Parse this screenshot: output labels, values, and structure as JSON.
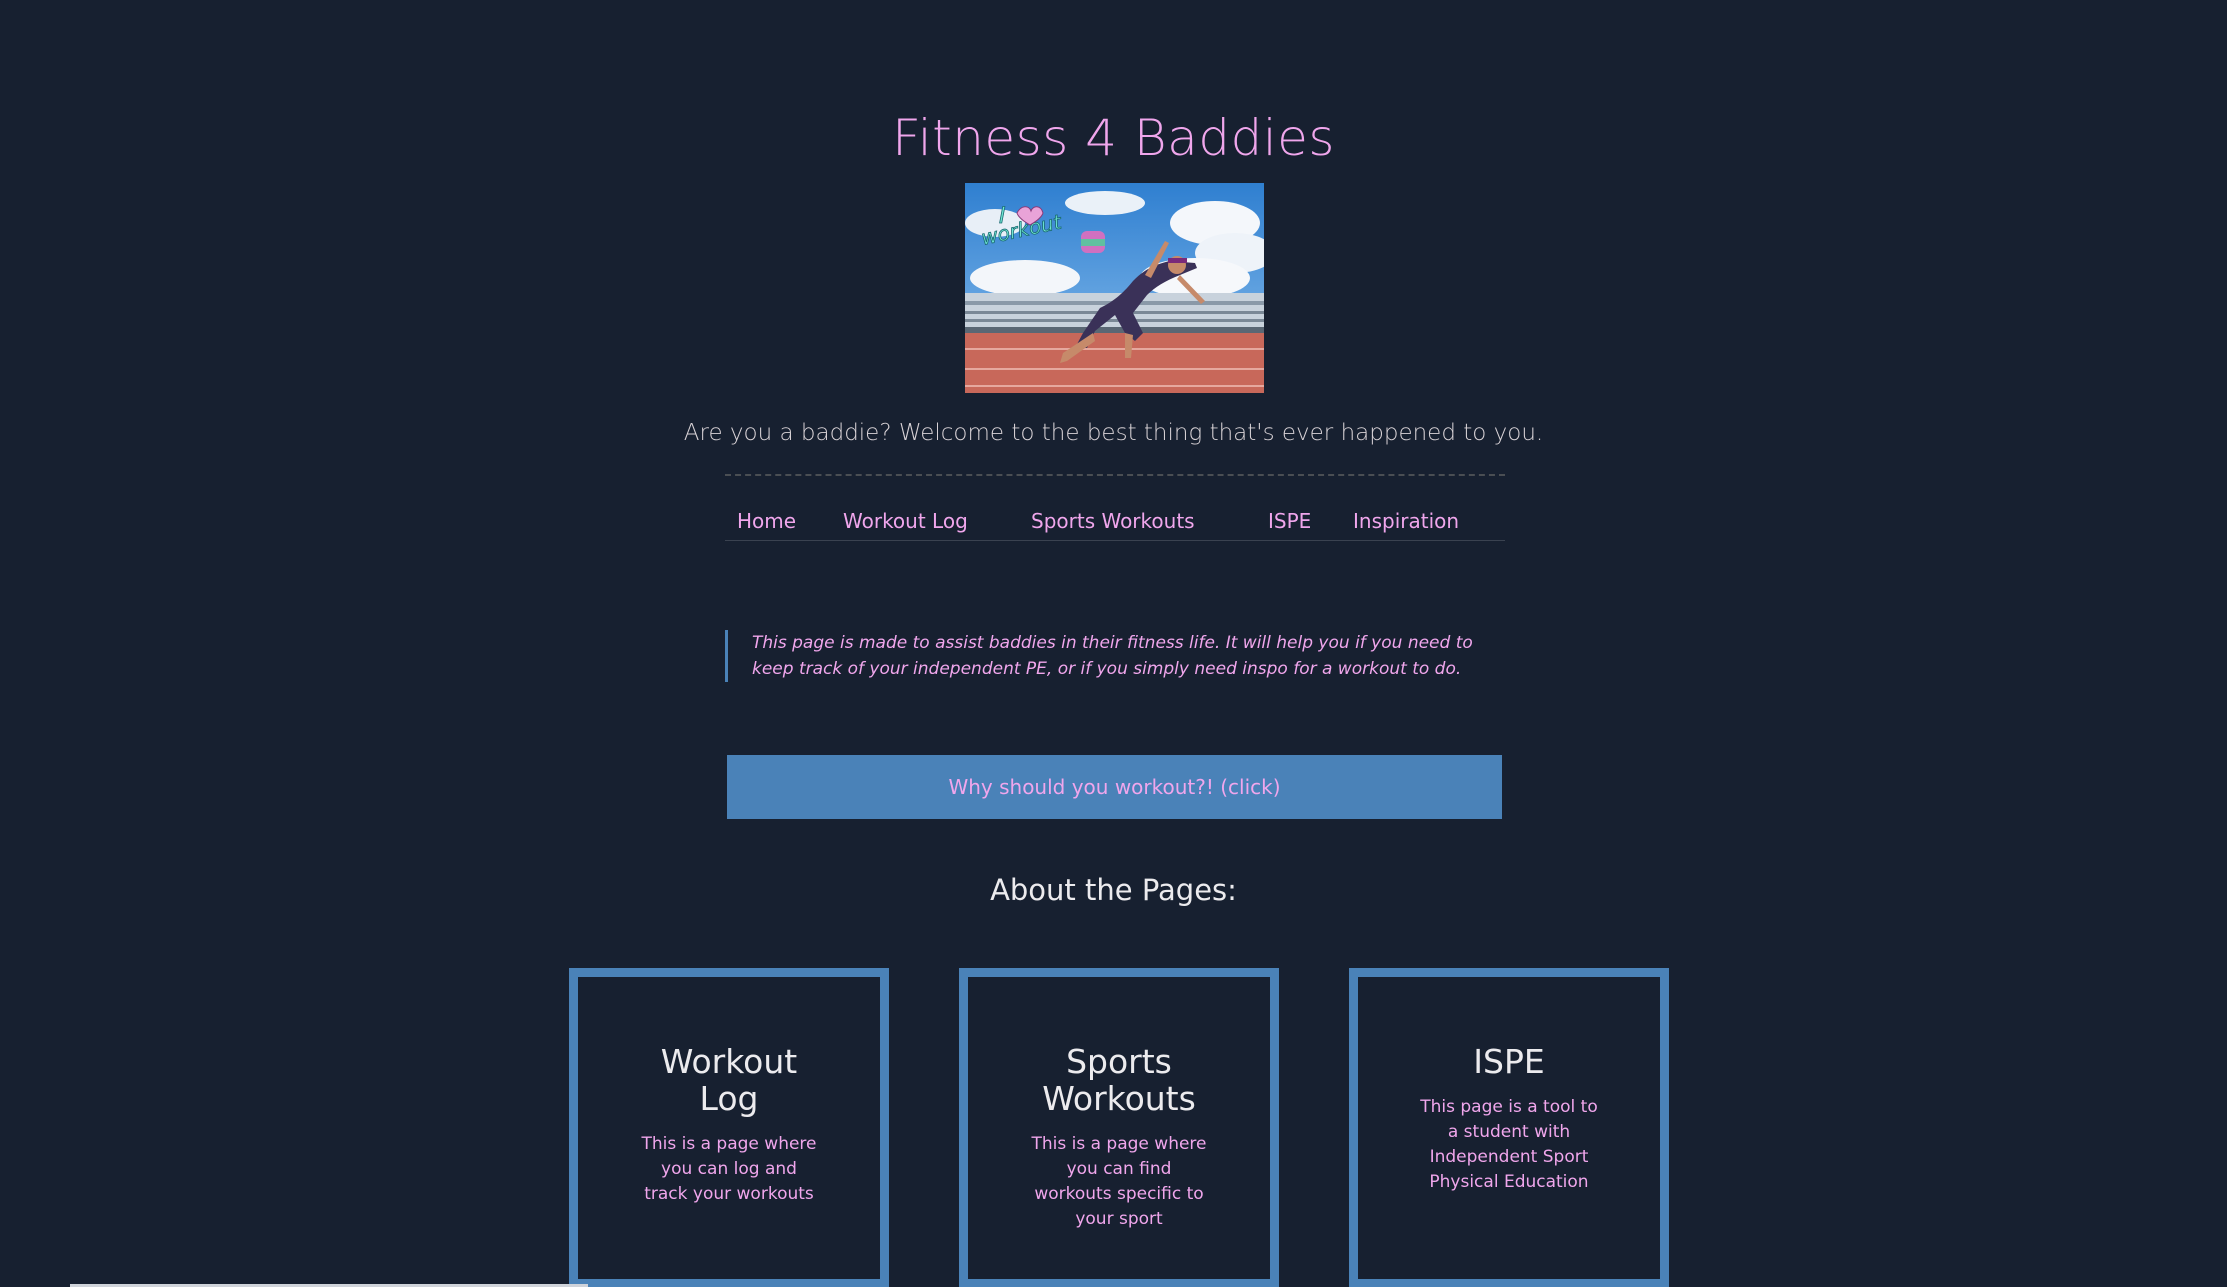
{
  "header": {
    "title": "Fitness 4 Baddies",
    "hero_image": {
      "alt": "I workout",
      "sticker_text_top": "I",
      "sticker_text_bottom": "workout"
    },
    "tagline": "Are you a baddie? Welcome to the best thing that's ever happened to you."
  },
  "nav": {
    "items": [
      {
        "label": "Home"
      },
      {
        "label": "Workout Log"
      },
      {
        "label": "Sports Workouts"
      },
      {
        "label": "ISPE"
      },
      {
        "label": "Inspiration"
      }
    ]
  },
  "intro": {
    "quote": "This page is made to assist baddies in their fitness life. It will help you if you need to keep track of your independent PE, or if you simply need inspo for a workout to do."
  },
  "cta": {
    "label": "Why should you workout?! (click)"
  },
  "about": {
    "title": "About the Pages:",
    "cards": [
      {
        "title": "Workout Log",
        "description": "This is a page where you can log and track your workouts"
      },
      {
        "title": "Sports Workouts",
        "description": "This is a page where you can find workouts specific to your sport"
      },
      {
        "title": "ISPE",
        "description": "This page is a tool to a student with Independent Sport Physical Education"
      }
    ]
  },
  "colors": {
    "background": "#172030",
    "accent_pink": "#f0a6ec",
    "accent_blue": "#4a82b8",
    "heading_text": "#ecebee"
  }
}
